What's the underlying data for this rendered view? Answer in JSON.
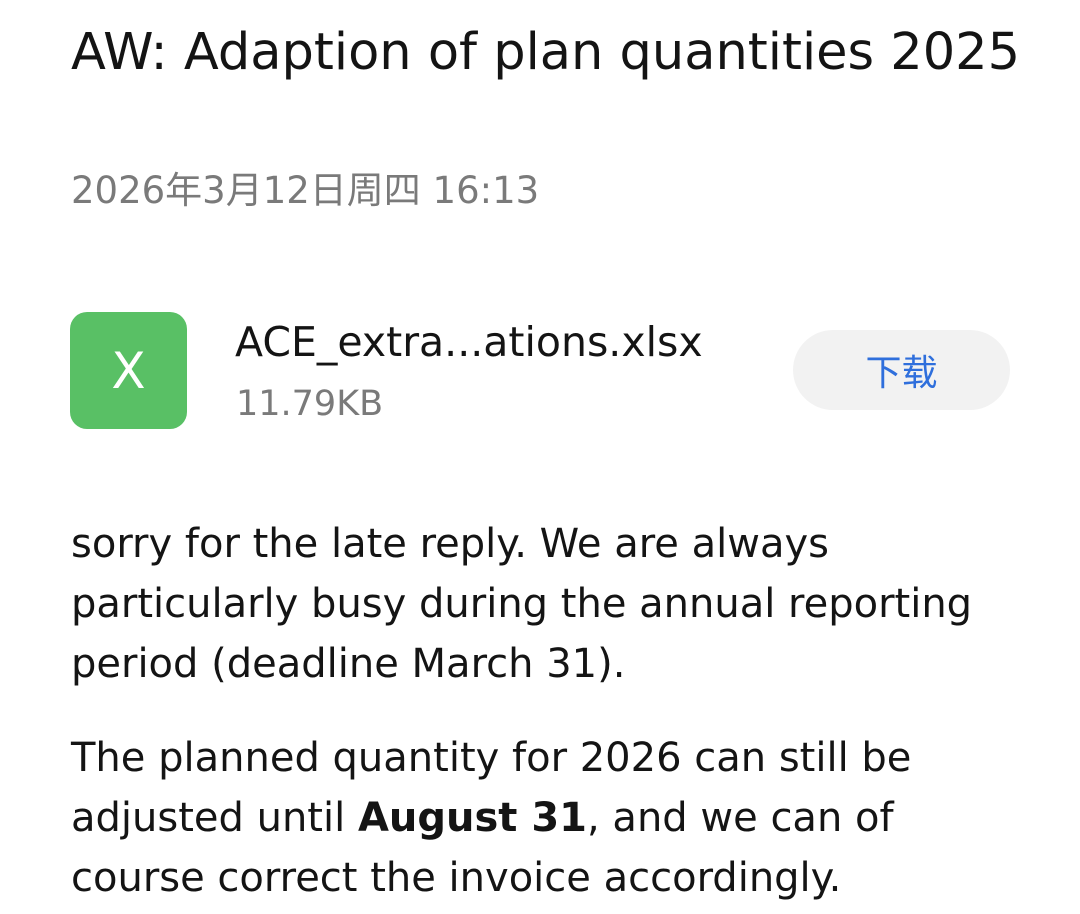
{
  "email": {
    "subject": "AW: Adaption of plan quantities 2025",
    "date": "2026年3月12日周四 16:13"
  },
  "attachment": {
    "icon_letter": "X",
    "icon_color": "#59c065",
    "file_name": "ACE_extra...ations.xlsx",
    "file_size": "11.79KB",
    "download_label": "下载",
    "download_color": "#2f6fdc"
  },
  "body": {
    "paragraph1": "sorry for the late reply. We are always particularly busy during the annual reporting period (deadline March 31).",
    "paragraph2_before": "The planned quantity for 2026 can still be adjusted until ",
    "paragraph2_bold": "August 31",
    "paragraph2_after": ", and we can of course correct the invoice accordingly."
  }
}
